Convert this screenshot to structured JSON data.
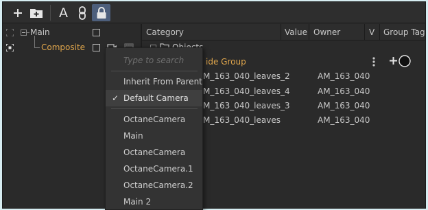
{
  "toolbar": {
    "buttons": [
      {
        "name": "add-icon"
      },
      {
        "name": "add-folder-icon"
      },
      {
        "name": "text-icon",
        "label": "A"
      },
      {
        "name": "link-icon"
      },
      {
        "name": "lock-icon"
      }
    ]
  },
  "left_panel": {
    "items": [
      {
        "label": "Main"
      },
      {
        "label": "Composite"
      }
    ]
  },
  "right_panel": {
    "columns": [
      "Category",
      "Value",
      "Owner",
      "V",
      "Group Tag"
    ],
    "objects_label": "Objects",
    "group_label": "ide Group",
    "rows": [
      {
        "category": "M_163_040_leaves_2",
        "owner": "AM_163_040"
      },
      {
        "category": "M_163_040_leaves_4",
        "owner": "AM_163_040"
      },
      {
        "category": "M_163_040_leaves_3",
        "owner": "AM_163_040"
      },
      {
        "category": "M_163_040_leaves",
        "owner": "AM_163_040"
      }
    ]
  },
  "dropdown": {
    "placeholder": "Type to search",
    "inherit_label": "Inherit From Parent",
    "selected_label": "Default Camera",
    "checkmark": "✓",
    "items": [
      "OctaneCamera",
      "Main",
      "OctaneCamera",
      "OctaneCamera.1",
      "OctaneCamera.2",
      "Main 2"
    ]
  },
  "colors": {
    "accent_orange": "#e0a64c",
    "lock_active": "#4d5f7c"
  }
}
